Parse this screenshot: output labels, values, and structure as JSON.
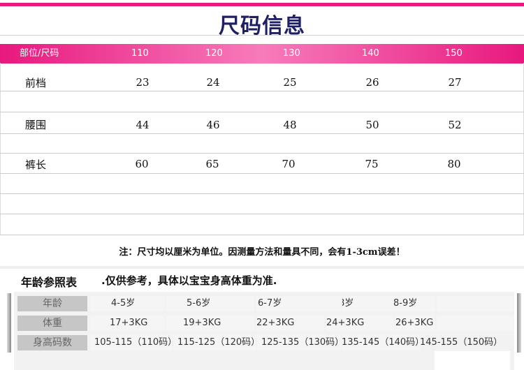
{
  "title": "尺码信息",
  "size_table": {
    "header": [
      "部位/尺码",
      "110",
      "120",
      "130",
      "140",
      "150"
    ],
    "rows": [
      {
        "label": "前档",
        "values": [
          "23",
          "24",
          "25",
          "26",
          "27"
        ]
      },
      {
        "label": "腰围",
        "values": [
          "44",
          "46",
          "48",
          "50",
          "52"
        ]
      },
      {
        "label": "裤长",
        "values": [
          "60",
          "65",
          "70",
          "75",
          "80"
        ]
      }
    ]
  },
  "note": "注：尺寸均以厘米为单位。因测量方法和量具不同，会有1-3cm误差！",
  "age_table": {
    "title": "年龄参照表",
    "subtitle": ".仅供参考，具体以宝宝身高体重为准.",
    "rows": [
      {
        "label": "年龄",
        "values": [
          "4-5岁",
          "5-6岁",
          "6-7岁",
          "7-8岁",
          "8-9岁",
          ""
        ]
      },
      {
        "label": "体重",
        "values": [
          "17+3KG",
          "19+3KG",
          "22+3KG",
          "24+3KG",
          "26+3KG",
          ""
        ]
      },
      {
        "label": "身高码数",
        "values": [
          "105-115（110码）",
          "115-125（120码）",
          "125-135（130码）",
          "135-145（140码）",
          "145-155（150码）",
          ""
        ]
      }
    ]
  },
  "colors": {
    "accent": "#e8187e",
    "title": "#1f1f66"
  }
}
